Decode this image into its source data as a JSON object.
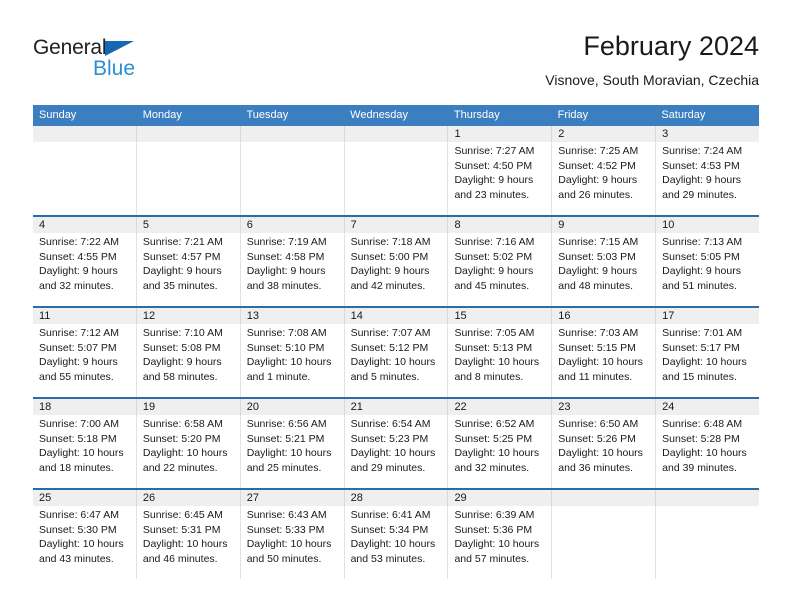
{
  "brand": {
    "name_top": "General",
    "name_bottom": "Blue",
    "triangle_color": "#1668b3",
    "blue_text_color": "#2a8fd4"
  },
  "header": {
    "title": "February 2024",
    "subtitle": "Visnove, South Moravian, Czechia"
  },
  "theme": {
    "header_bg": "#3c7fc1",
    "row_divider": "#2b6ca8",
    "daynum_band_bg": "#efefef"
  },
  "weekdays": [
    "Sunday",
    "Monday",
    "Tuesday",
    "Wednesday",
    "Thursday",
    "Friday",
    "Saturday"
  ],
  "weeks": [
    {
      "days": [
        {
          "num": "",
          "lines": []
        },
        {
          "num": "",
          "lines": []
        },
        {
          "num": "",
          "lines": []
        },
        {
          "num": "",
          "lines": []
        },
        {
          "num": "1",
          "lines": [
            "Sunrise: 7:27 AM",
            "Sunset: 4:50 PM",
            "Daylight: 9 hours",
            "and 23 minutes."
          ]
        },
        {
          "num": "2",
          "lines": [
            "Sunrise: 7:25 AM",
            "Sunset: 4:52 PM",
            "Daylight: 9 hours",
            "and 26 minutes."
          ]
        },
        {
          "num": "3",
          "lines": [
            "Sunrise: 7:24 AM",
            "Sunset: 4:53 PM",
            "Daylight: 9 hours",
            "and 29 minutes."
          ]
        }
      ]
    },
    {
      "days": [
        {
          "num": "4",
          "lines": [
            "Sunrise: 7:22 AM",
            "Sunset: 4:55 PM",
            "Daylight: 9 hours",
            "and 32 minutes."
          ]
        },
        {
          "num": "5",
          "lines": [
            "Sunrise: 7:21 AM",
            "Sunset: 4:57 PM",
            "Daylight: 9 hours",
            "and 35 minutes."
          ]
        },
        {
          "num": "6",
          "lines": [
            "Sunrise: 7:19 AM",
            "Sunset: 4:58 PM",
            "Daylight: 9 hours",
            "and 38 minutes."
          ]
        },
        {
          "num": "7",
          "lines": [
            "Sunrise: 7:18 AM",
            "Sunset: 5:00 PM",
            "Daylight: 9 hours",
            "and 42 minutes."
          ]
        },
        {
          "num": "8",
          "lines": [
            "Sunrise: 7:16 AM",
            "Sunset: 5:02 PM",
            "Daylight: 9 hours",
            "and 45 minutes."
          ]
        },
        {
          "num": "9",
          "lines": [
            "Sunrise: 7:15 AM",
            "Sunset: 5:03 PM",
            "Daylight: 9 hours",
            "and 48 minutes."
          ]
        },
        {
          "num": "10",
          "lines": [
            "Sunrise: 7:13 AM",
            "Sunset: 5:05 PM",
            "Daylight: 9 hours",
            "and 51 minutes."
          ]
        }
      ]
    },
    {
      "days": [
        {
          "num": "11",
          "lines": [
            "Sunrise: 7:12 AM",
            "Sunset: 5:07 PM",
            "Daylight: 9 hours",
            "and 55 minutes."
          ]
        },
        {
          "num": "12",
          "lines": [
            "Sunrise: 7:10 AM",
            "Sunset: 5:08 PM",
            "Daylight: 9 hours",
            "and 58 minutes."
          ]
        },
        {
          "num": "13",
          "lines": [
            "Sunrise: 7:08 AM",
            "Sunset: 5:10 PM",
            "Daylight: 10 hours",
            "and 1 minute."
          ]
        },
        {
          "num": "14",
          "lines": [
            "Sunrise: 7:07 AM",
            "Sunset: 5:12 PM",
            "Daylight: 10 hours",
            "and 5 minutes."
          ]
        },
        {
          "num": "15",
          "lines": [
            "Sunrise: 7:05 AM",
            "Sunset: 5:13 PM",
            "Daylight: 10 hours",
            "and 8 minutes."
          ]
        },
        {
          "num": "16",
          "lines": [
            "Sunrise: 7:03 AM",
            "Sunset: 5:15 PM",
            "Daylight: 10 hours",
            "and 11 minutes."
          ]
        },
        {
          "num": "17",
          "lines": [
            "Sunrise: 7:01 AM",
            "Sunset: 5:17 PM",
            "Daylight: 10 hours",
            "and 15 minutes."
          ]
        }
      ]
    },
    {
      "days": [
        {
          "num": "18",
          "lines": [
            "Sunrise: 7:00 AM",
            "Sunset: 5:18 PM",
            "Daylight: 10 hours",
            "and 18 minutes."
          ]
        },
        {
          "num": "19",
          "lines": [
            "Sunrise: 6:58 AM",
            "Sunset: 5:20 PM",
            "Daylight: 10 hours",
            "and 22 minutes."
          ]
        },
        {
          "num": "20",
          "lines": [
            "Sunrise: 6:56 AM",
            "Sunset: 5:21 PM",
            "Daylight: 10 hours",
            "and 25 minutes."
          ]
        },
        {
          "num": "21",
          "lines": [
            "Sunrise: 6:54 AM",
            "Sunset: 5:23 PM",
            "Daylight: 10 hours",
            "and 29 minutes."
          ]
        },
        {
          "num": "22",
          "lines": [
            "Sunrise: 6:52 AM",
            "Sunset: 5:25 PM",
            "Daylight: 10 hours",
            "and 32 minutes."
          ]
        },
        {
          "num": "23",
          "lines": [
            "Sunrise: 6:50 AM",
            "Sunset: 5:26 PM",
            "Daylight: 10 hours",
            "and 36 minutes."
          ]
        },
        {
          "num": "24",
          "lines": [
            "Sunrise: 6:48 AM",
            "Sunset: 5:28 PM",
            "Daylight: 10 hours",
            "and 39 minutes."
          ]
        }
      ]
    },
    {
      "days": [
        {
          "num": "25",
          "lines": [
            "Sunrise: 6:47 AM",
            "Sunset: 5:30 PM",
            "Daylight: 10 hours",
            "and 43 minutes."
          ]
        },
        {
          "num": "26",
          "lines": [
            "Sunrise: 6:45 AM",
            "Sunset: 5:31 PM",
            "Daylight: 10 hours",
            "and 46 minutes."
          ]
        },
        {
          "num": "27",
          "lines": [
            "Sunrise: 6:43 AM",
            "Sunset: 5:33 PM",
            "Daylight: 10 hours",
            "and 50 minutes."
          ]
        },
        {
          "num": "28",
          "lines": [
            "Sunrise: 6:41 AM",
            "Sunset: 5:34 PM",
            "Daylight: 10 hours",
            "and 53 minutes."
          ]
        },
        {
          "num": "29",
          "lines": [
            "Sunrise: 6:39 AM",
            "Sunset: 5:36 PM",
            "Daylight: 10 hours",
            "and 57 minutes."
          ]
        },
        {
          "num": "",
          "lines": []
        },
        {
          "num": "",
          "lines": []
        }
      ]
    }
  ]
}
